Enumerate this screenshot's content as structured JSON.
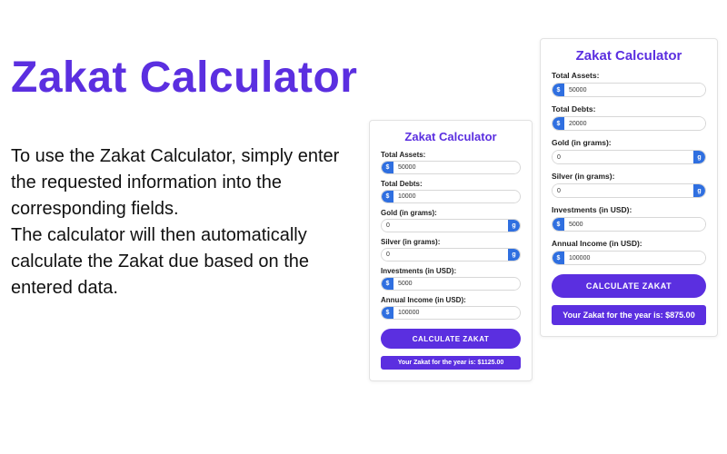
{
  "hero": {
    "title": "Zakat Calculator",
    "description": "To use the Zakat Calculator, simply enter the requested information into the corresponding fields.\nThe calculator will then automatically calculate the Zakat due based on the entered data."
  },
  "cardA": {
    "title": "Zakat Calculator",
    "labels": {
      "assets": "Total Assets:",
      "debts": "Total Debts:",
      "gold": "Gold (in grams):",
      "silver": "Silver (in grams):",
      "investments": "Investments (in USD):",
      "income": "Annual Income (in USD):"
    },
    "values": {
      "assets": "50000",
      "debts": "10000",
      "gold": "0",
      "silver": "0",
      "investments": "5000",
      "income": "100000"
    },
    "unit_suffix": {
      "gold": "g",
      "silver": "g"
    },
    "currency_prefix": "$",
    "button": "CALCULATE ZAKAT",
    "result": "Your Zakat for the year is: $1125.00"
  },
  "cardB": {
    "title": "Zakat Calculator",
    "labels": {
      "assets": "Total Assets:",
      "debts": "Total Debts:",
      "gold": "Gold (in grams):",
      "silver": "Silver (in grams):",
      "investments": "Investments (in USD):",
      "income": "Annual Income (in USD):"
    },
    "values": {
      "assets": "50000",
      "debts": "20000",
      "gold": "0",
      "silver": "0",
      "investments": "5000",
      "income": "100000"
    },
    "unit_suffix": {
      "gold": "g",
      "silver": "g"
    },
    "currency_prefix": "$",
    "button": "CALCULATE ZAKAT",
    "result": "Your Zakat for the year is: $875.00"
  }
}
